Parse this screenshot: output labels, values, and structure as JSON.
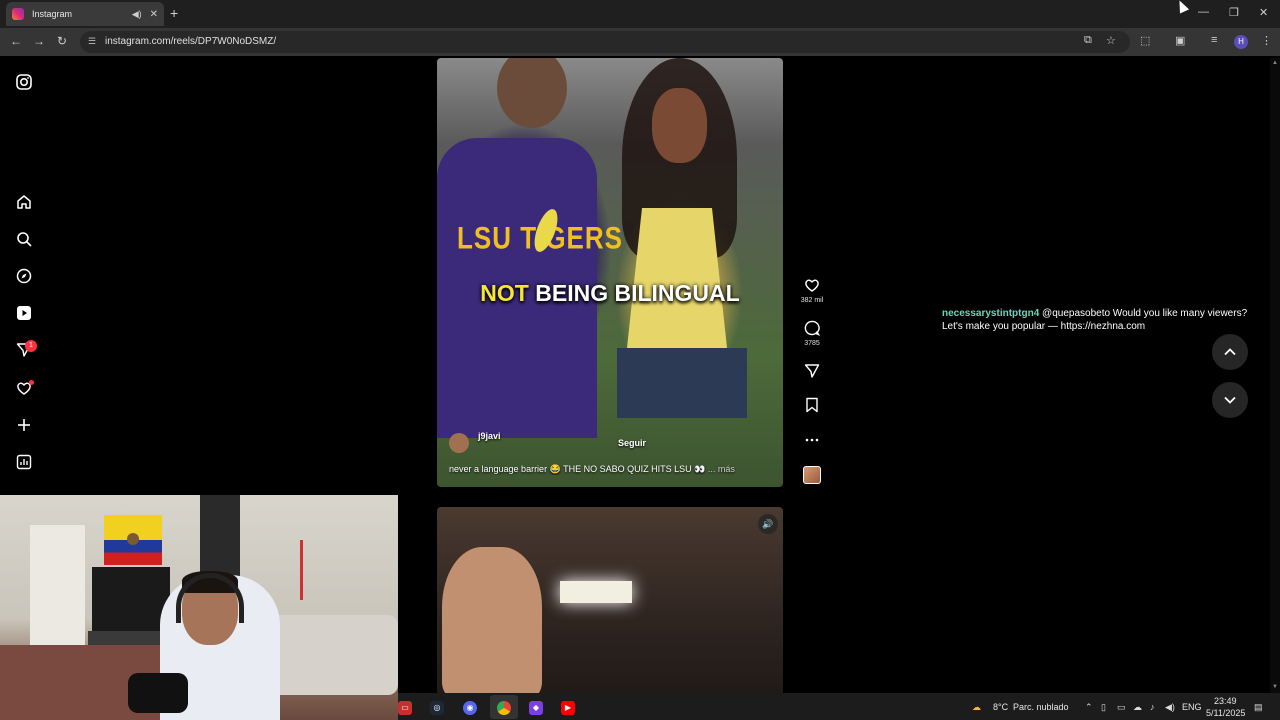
{
  "browser": {
    "tab": {
      "title": "Instagram"
    },
    "url": "instagram.com/reels/DP7W0NoDSMZ/",
    "profile_initial": "H"
  },
  "sidebar": {
    "notifications_badge": "1"
  },
  "reel": {
    "caption_highlight": "NOT",
    "caption_rest": "BEING BILINGUAL",
    "shirt_text": "LSU TIGERS",
    "author": "j9javi",
    "follow_label": "Seguir",
    "description": "never a language barrier 😂 THE NO SABO QUIZ HITS LSU 👀",
    "more_label": "... más",
    "likes": "382 mil",
    "comments": "3785"
  },
  "chat": {
    "username": "necessarystintptgn4",
    "message": "@quepasobeto Would you like many viewers? Let's make you popular — https://nezhna.com"
  },
  "taskbar": {
    "weather_temp": "8°C",
    "weather_desc": "Parc. nublado",
    "language": "ENG",
    "time": "23:49",
    "date": "5/11/2025"
  },
  "colors": {
    "accent_red": "#ff3040",
    "chat_user": "#69d6b8",
    "caption_yellow": "#f7e43a"
  }
}
